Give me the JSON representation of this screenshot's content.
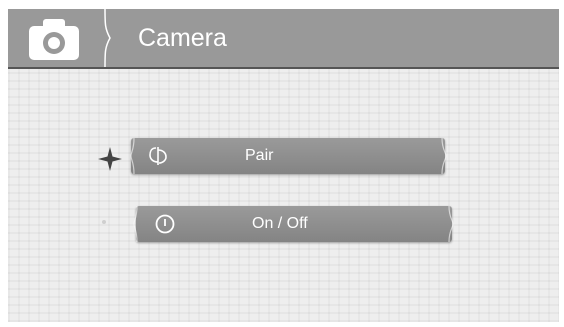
{
  "header": {
    "title": "Camera",
    "icon": "camera-icon"
  },
  "menu": {
    "items": [
      {
        "label": "Pair",
        "icon": "pair-icon",
        "selected": true
      },
      {
        "label": "On / Off",
        "icon": "power-icon",
        "selected": false
      }
    ]
  },
  "colors": {
    "header_bg": "#999999",
    "button_bg": "#8f8f8f",
    "text": "#ffffff",
    "screen_bg": "#eeeeee"
  }
}
